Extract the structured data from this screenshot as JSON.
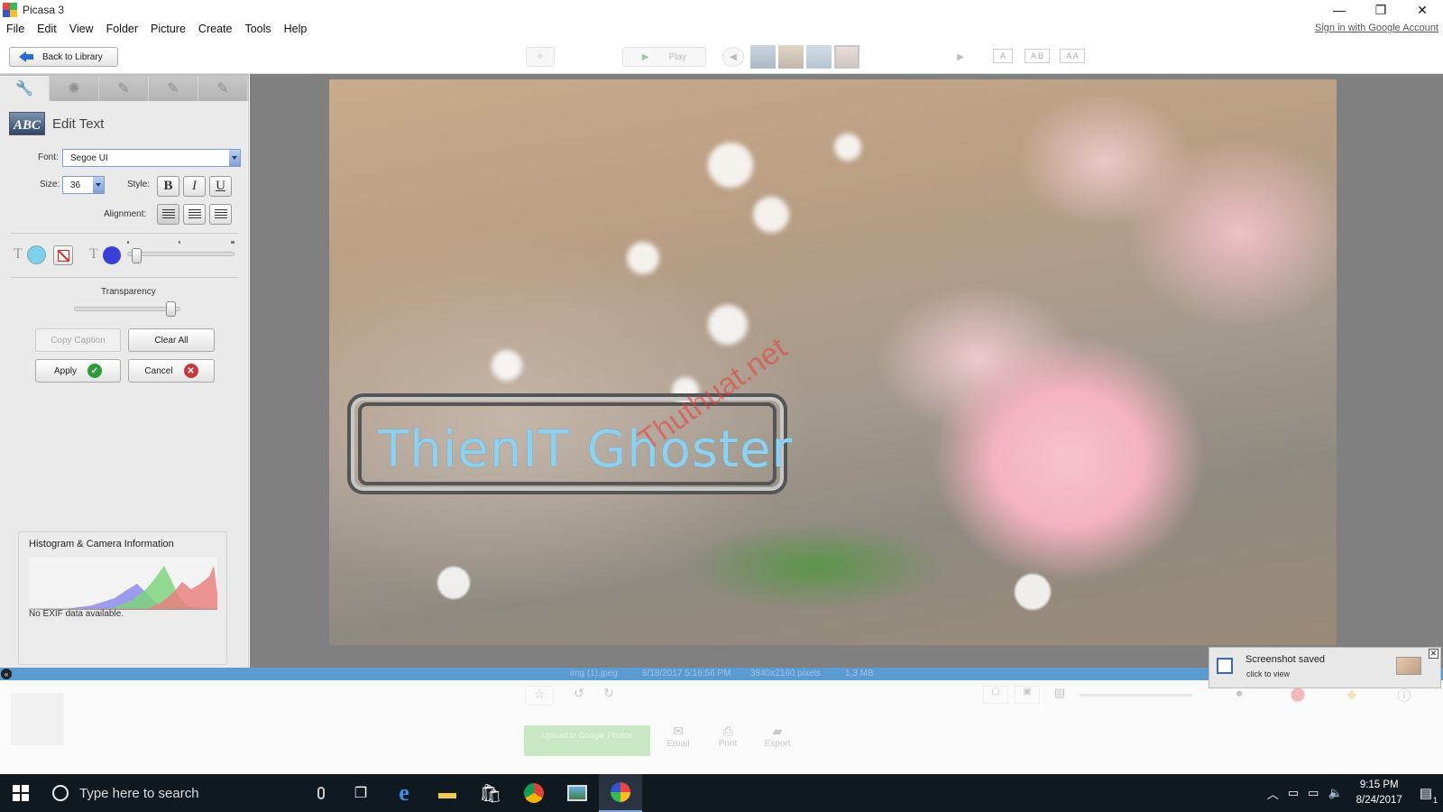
{
  "window": {
    "title": "Picasa 3",
    "minimize": "—",
    "restore": "❐",
    "close": "✕"
  },
  "menu": [
    "File",
    "Edit",
    "View",
    "Folder",
    "Picture",
    "Create",
    "Tools",
    "Help"
  ],
  "account": {
    "signin_label": "Sign in with Google Account"
  },
  "toolbar": {
    "back_label": "Back to Library",
    "play_label": "Play",
    "view_modes": [
      "A",
      "A B",
      "A A"
    ]
  },
  "edit_panel": {
    "title": "Edit Text",
    "header_icon_text": "ABC",
    "font_label": "Font:",
    "font_value": "Segoe UI",
    "size_label": "Size:",
    "size_value": "36",
    "style_label": "Style:",
    "style_buttons": [
      "B",
      "I",
      "U"
    ],
    "alignment_label": "Alignment:",
    "text_color_glyph": "T",
    "outline_color_glyph": "T",
    "text_color": "#7fd0ee",
    "outline_color": "#3a3fd6",
    "no_fill_color": "#d62222",
    "outline_thickness": 0.05,
    "transparency_label": "Transparency",
    "transparency": 0.95,
    "copy_caption_label": "Copy Caption",
    "clear_all_label": "Clear All",
    "apply_label": "Apply",
    "cancel_label": "Cancel"
  },
  "histogram": {
    "title": "Histogram & Camera Information",
    "note": "No EXIF data available."
  },
  "photo": {
    "caption_text": "ThienIT Ghoster",
    "watermark": "Thuthuat.net"
  },
  "info_bar": {
    "filename": "img (1).jpeg",
    "date": "8/18/2017 5:16:56 PM",
    "dimensions": "3840x2160 pixels",
    "size": "1.3 MB"
  },
  "bottom_tray": {
    "upload_label": "Upload to Google Photos",
    "email_label": "Email",
    "print_label": "Print",
    "export_label": "Export"
  },
  "notification": {
    "title": "Screenshot saved",
    "subtitle": "click to view"
  },
  "taskbar": {
    "search_placeholder": "Type here to search",
    "time": "9:15 PM",
    "date": "8/24/2017",
    "notification_count": "1"
  }
}
